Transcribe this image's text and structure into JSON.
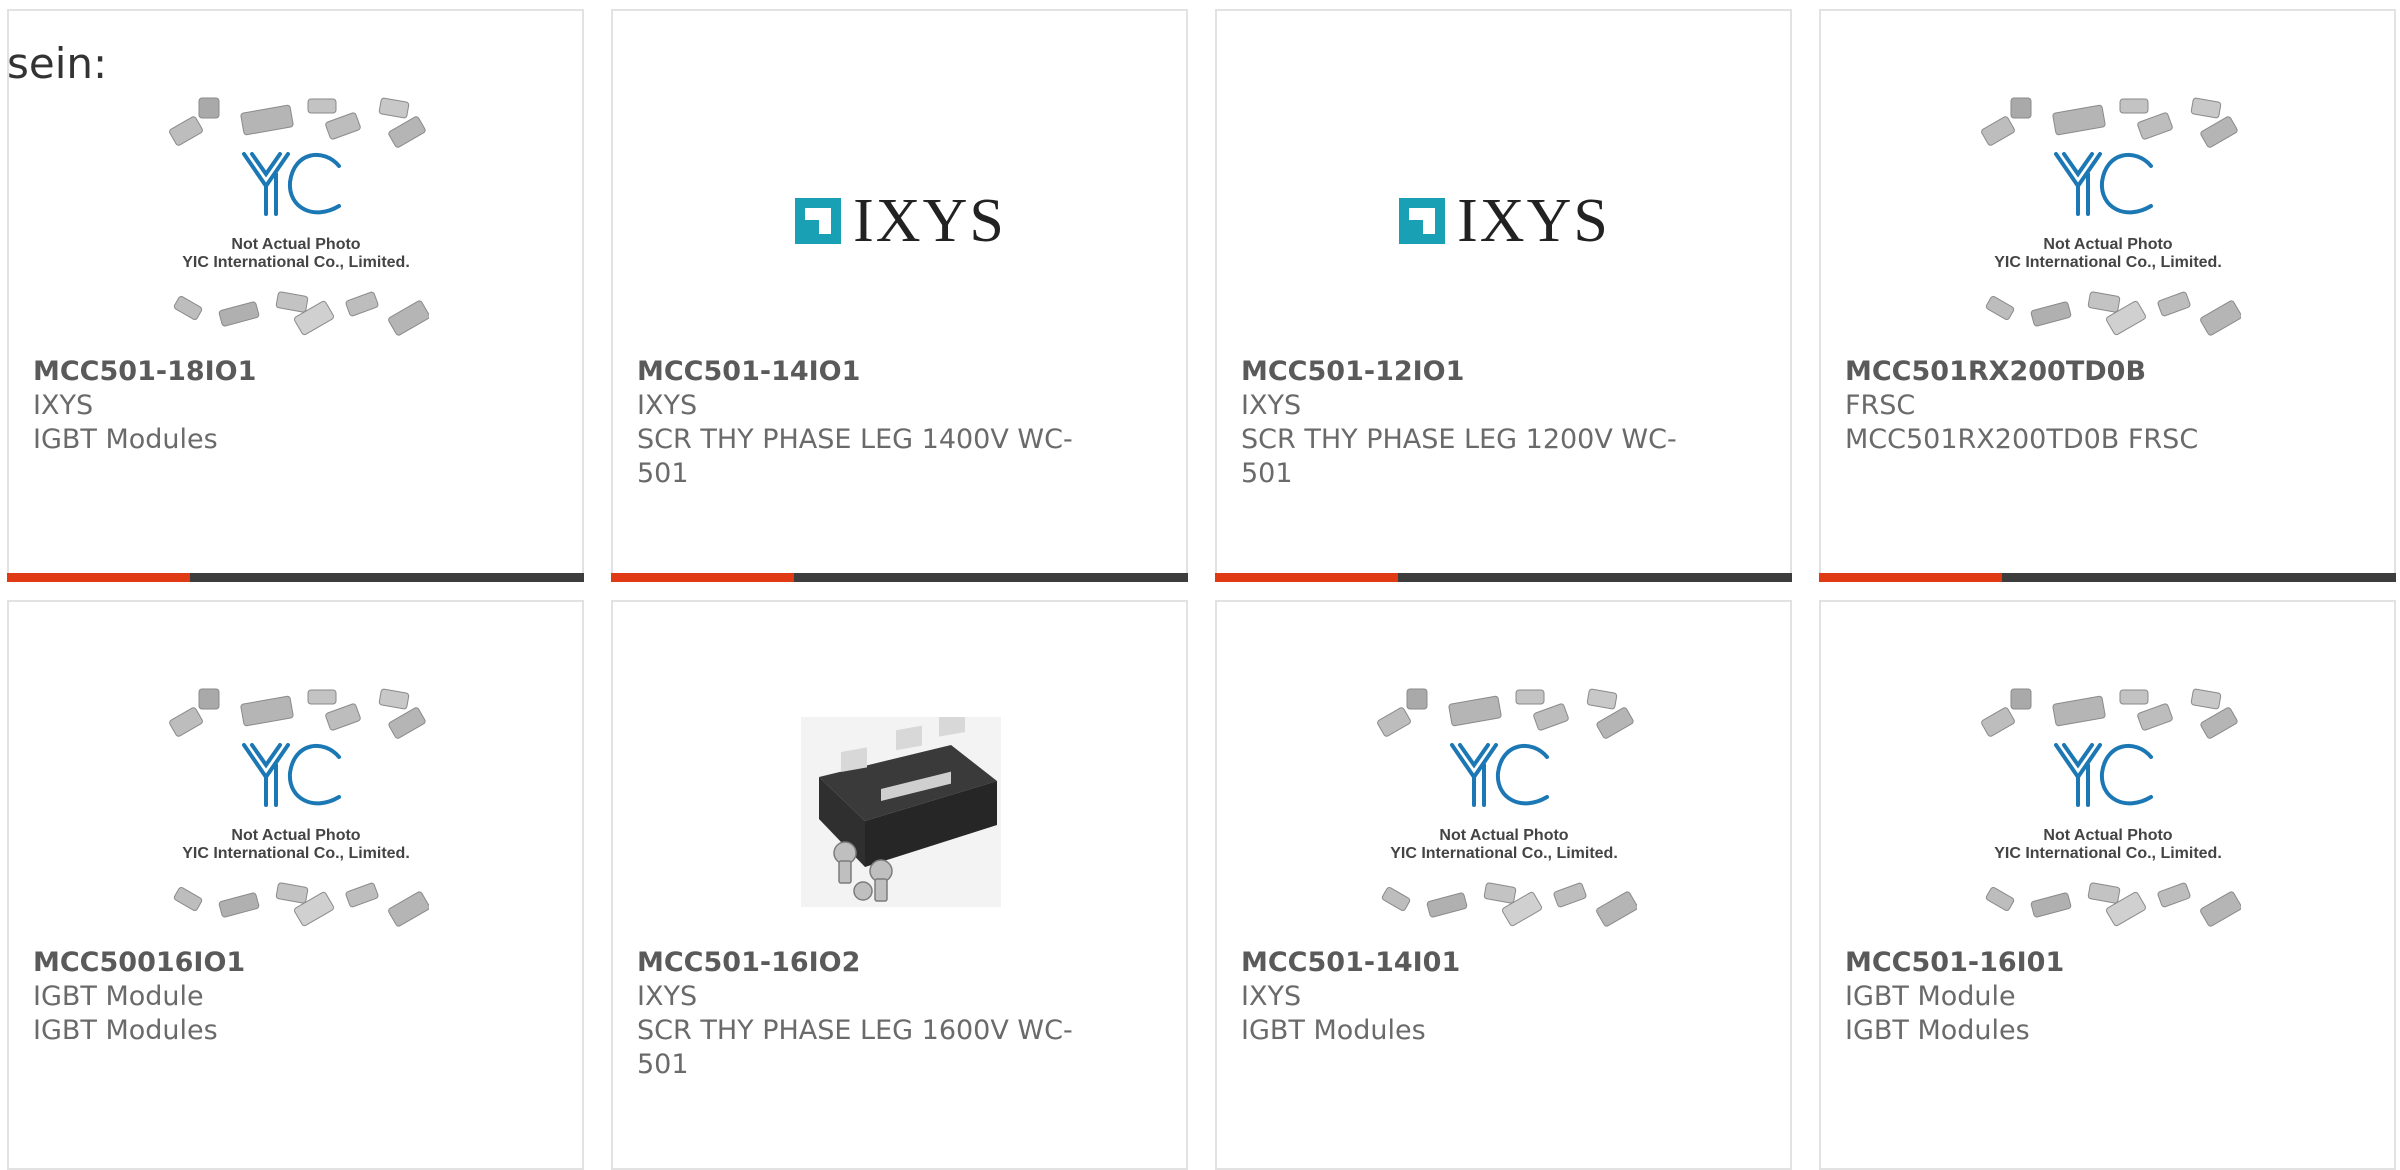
{
  "intro_text": "sein:",
  "placeholder": {
    "line1": "Not Actual Photo",
    "line2": "YIC International Co., Limited.",
    "logo_text": "YIC"
  },
  "brand_logo": {
    "text": "IXYS",
    "color": "#1aa0b4"
  },
  "accent_color": "#e03a14",
  "bar_color": "#3d3d3d",
  "products": [
    {
      "part": "MCC501-18IO1",
      "mfr": "IXYS",
      "desc": "IGBT Modules",
      "image": "yic-placeholder"
    },
    {
      "part": "MCC501-14IO1",
      "mfr": "IXYS",
      "desc": "SCR THY PHASE LEG 1400V WC-501",
      "image": "ixys-logo"
    },
    {
      "part": "MCC501-12IO1",
      "mfr": "IXYS",
      "desc": "SCR THY PHASE LEG 1200V WC-501",
      "image": "ixys-logo"
    },
    {
      "part": "MCC501RX200TD0B",
      "mfr": "FRSC",
      "desc": "MCC501RX200TD0B FRSC",
      "image": "yic-placeholder"
    },
    {
      "part": "MCC50016IO1",
      "mfr": "IGBT Module",
      "desc": "IGBT Modules",
      "image": "yic-placeholder"
    },
    {
      "part": "MCC501-16IO2",
      "mfr": "IXYS",
      "desc": "SCR THY PHASE LEG 1600V WC-501",
      "image": "module-photo"
    },
    {
      "part": "MCC501-14I01",
      "mfr": "IXYS",
      "desc": "IGBT Modules",
      "image": "yic-placeholder"
    },
    {
      "part": "MCC501-16I01",
      "mfr": "IGBT Module",
      "desc": "IGBT Modules",
      "image": "yic-placeholder"
    }
  ]
}
